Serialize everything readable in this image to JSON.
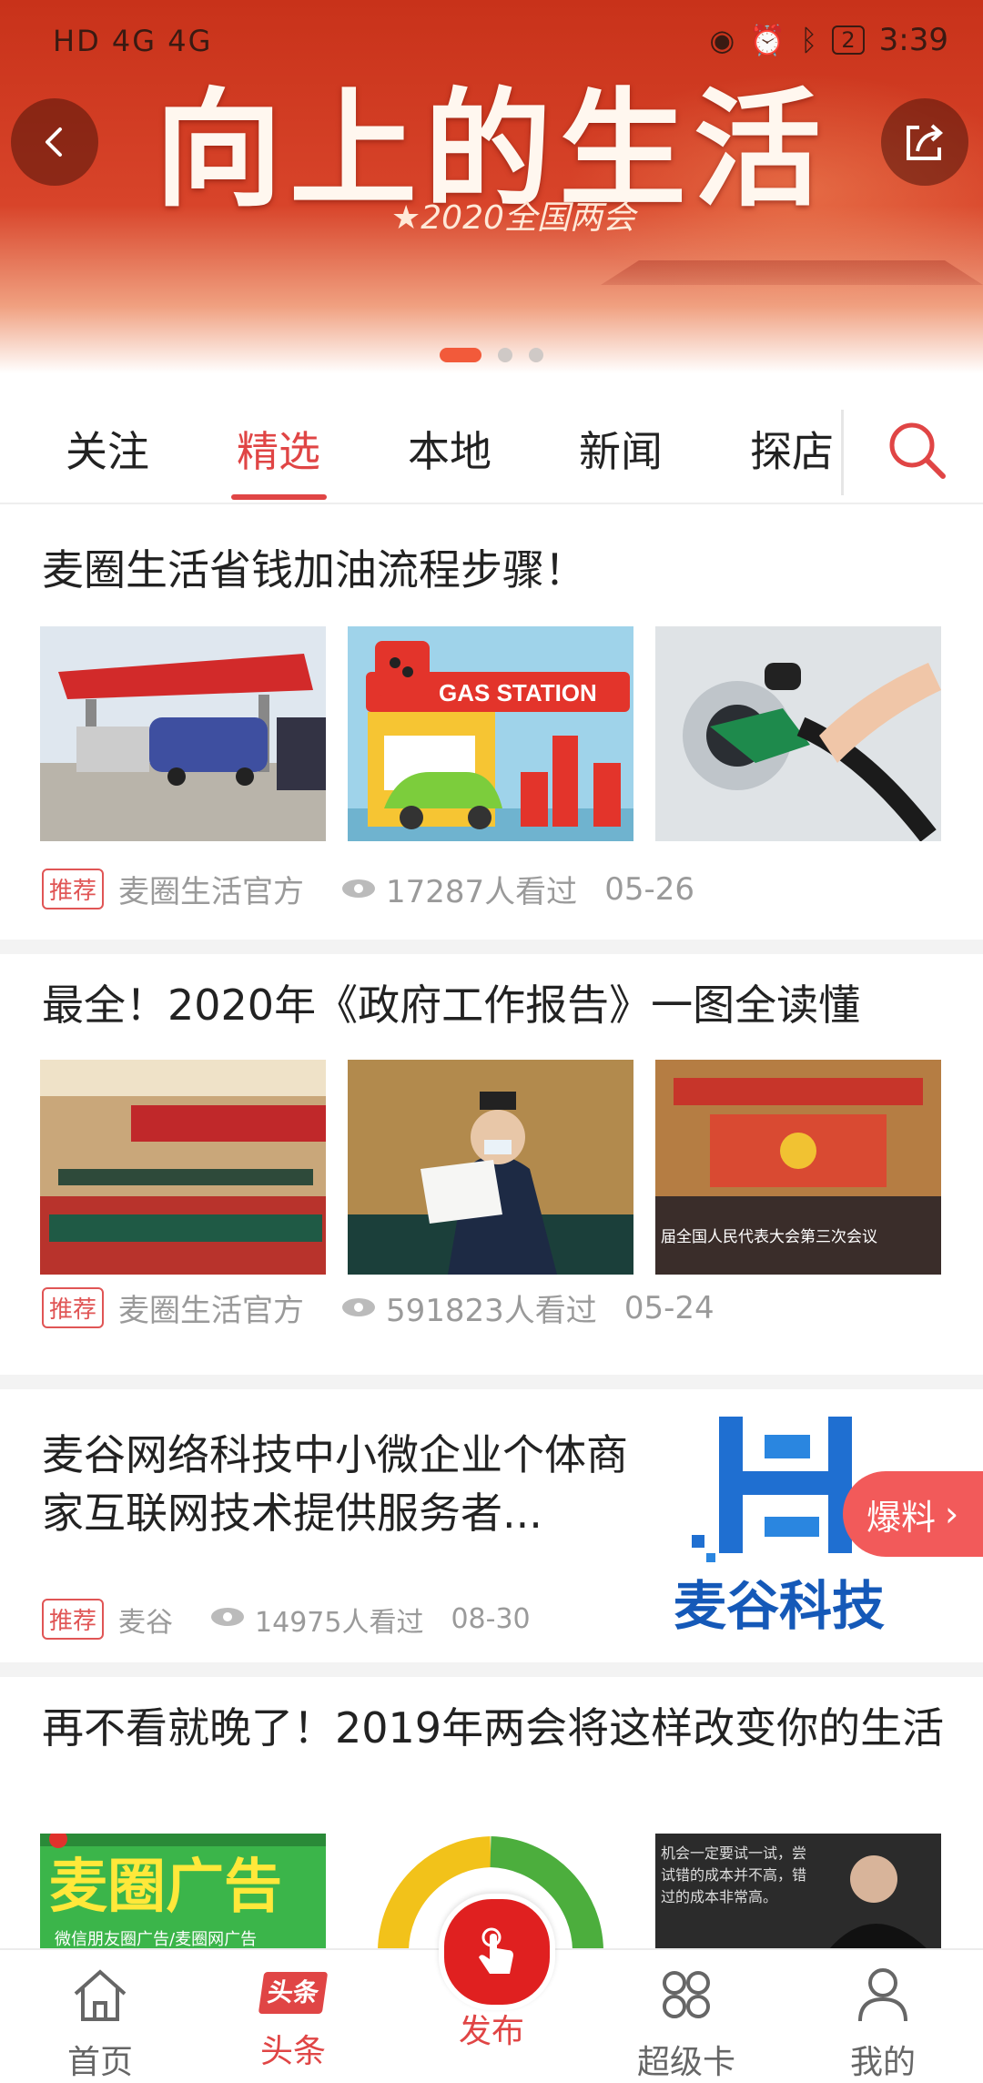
{
  "status_bar": {
    "signal_text": "HD 4G 4G",
    "battery": "2",
    "time": "3:39"
  },
  "banner": {
    "title": "向上的生活",
    "subtitle": "★2020全国两会",
    "page_count": 3,
    "active_page": 1
  },
  "tabs": [
    {
      "label": "关注"
    },
    {
      "label": "精选"
    },
    {
      "label": "本地"
    },
    {
      "label": "新闻"
    },
    {
      "label": "探店"
    }
  ],
  "active_tab": "精选",
  "articles": [
    {
      "title": "麦圈生活省钱加油流程步骤！",
      "tag": "推荐",
      "source": "麦圈生活官方",
      "views": "17287人看过",
      "date": "05-26",
      "images": [
        "gas-station-trucks-image",
        "gas-station-cartoon-image",
        "fuel-nozzle-image"
      ],
      "image_text": "GAS STATION"
    },
    {
      "title": "最全！2020年《政府工作报告》一图全读懂",
      "tag": "推荐",
      "source": "麦圈生活官方",
      "views": "591823人看过",
      "date": "05-24",
      "images": [
        "meeting-hall-image",
        "official-reading-image",
        "assembly-hall-image"
      ],
      "image_caption": "届全国人民代表大会第三次会议"
    },
    {
      "title": "麦谷网络科技中小微企业个体商家互联网技术提供服务者...",
      "tag": "推荐",
      "source": "麦谷",
      "views": "14975人看过",
      "date": "08-30",
      "logo_text": "麦谷科技"
    },
    {
      "title": "再不看就晚了！2019年两会将这样改变你的生活",
      "image_texts": [
        "麦圈广告",
        "微信朋友圈广告/麦圈网广告",
        "机会一定要试一试，尝试错的成本并不高，错过的成本非常高。"
      ]
    }
  ],
  "floating_badge": {
    "label": "爆料"
  },
  "bottom_nav": [
    {
      "label": "首页",
      "icon": "home-icon"
    },
    {
      "label": "头条",
      "icon": "headline-icon",
      "icon_text": "头条"
    },
    {
      "label": "发布",
      "icon": "tap-hand-icon"
    },
    {
      "label": "超级卡",
      "icon": "grid-icon"
    },
    {
      "label": "我的",
      "icon": "user-icon"
    }
  ],
  "colors": {
    "accent": "#e04545",
    "banner": "#d8442a",
    "badge": "#f25a5a",
    "publish": "#e02020"
  }
}
